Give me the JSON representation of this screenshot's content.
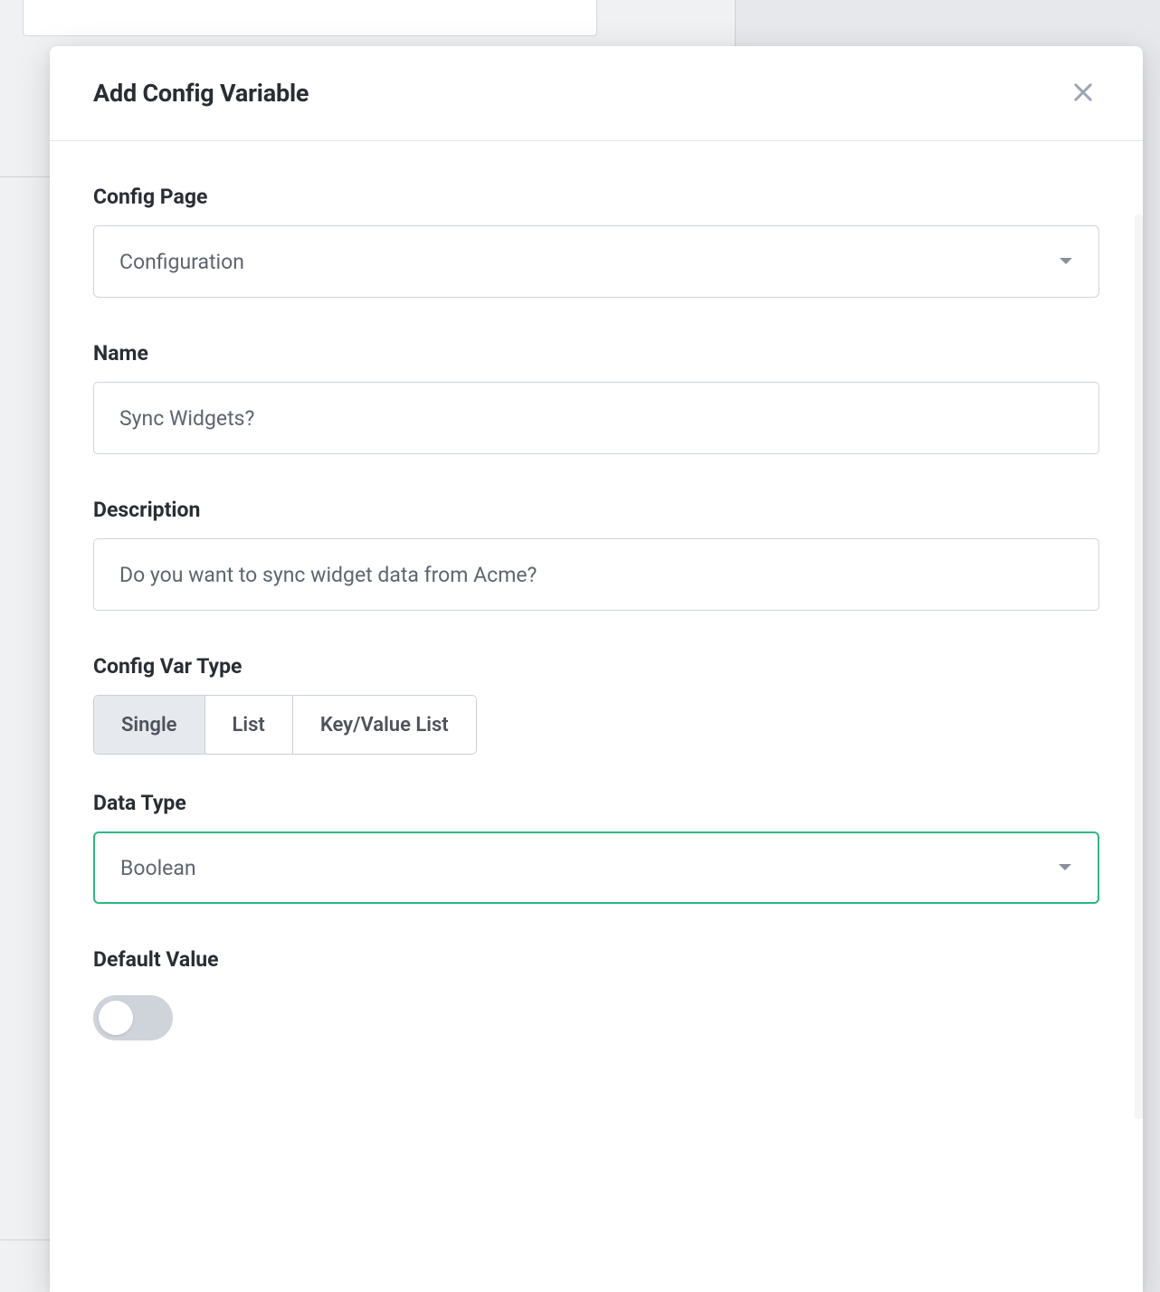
{
  "modal": {
    "title": "Add Config Variable"
  },
  "fields": {
    "config_page": {
      "label": "Config Page",
      "value": "Configuration"
    },
    "name": {
      "label": "Name",
      "value": "Sync Widgets?"
    },
    "description": {
      "label": "Description",
      "value": "Do you want to sync widget data from Acme?"
    },
    "config_var_type": {
      "label": "Config Var Type",
      "options": [
        "Single",
        "List",
        "Key/Value List"
      ],
      "selected_index": 0
    },
    "data_type": {
      "label": "Data Type",
      "value": "Boolean"
    },
    "default_value": {
      "label": "Default Value",
      "value": false
    }
  }
}
